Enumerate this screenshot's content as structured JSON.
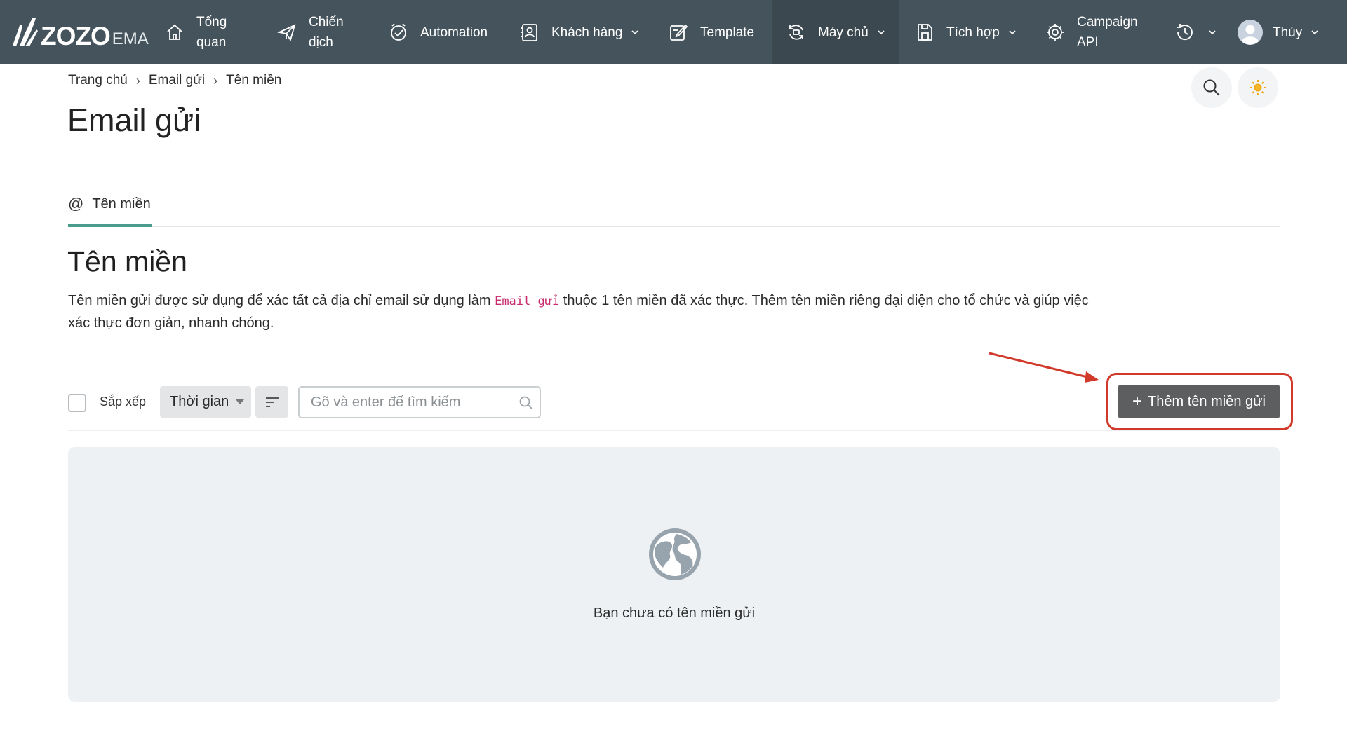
{
  "brand": {
    "name": "ZOZO",
    "suffix": "EMA"
  },
  "nav": {
    "items": [
      {
        "id": "overview",
        "label_line1": "Tổng",
        "label_line2": "quan",
        "icon": "home-icon"
      },
      {
        "id": "campaign",
        "label_line1": "Chiến",
        "label_line2": "dịch",
        "icon": "paper-plane-icon"
      },
      {
        "id": "automation",
        "label": "Automation",
        "icon": "clock-check-icon"
      },
      {
        "id": "customers",
        "label": "Khách hàng",
        "icon": "contacts-icon",
        "dropdown": true
      },
      {
        "id": "template",
        "label": "Template",
        "icon": "edit-icon"
      },
      {
        "id": "servers",
        "label": "Máy chủ",
        "icon": "server-sync-icon",
        "dropdown": true,
        "active": true
      },
      {
        "id": "integration",
        "label": "Tích hợp",
        "icon": "integration-icon",
        "dropdown": true
      },
      {
        "id": "campaign_api",
        "label_line1": "Campaign",
        "label_line2": "API",
        "icon": "gear-api-icon"
      }
    ],
    "history_icon": "history-icon",
    "user": {
      "name": "Thúy",
      "icon": "avatar-icon"
    }
  },
  "breadcrumb": [
    "Trang chủ",
    "Email gửi",
    "Tên miền"
  ],
  "breadcrumb_separator": "›",
  "page": {
    "title": "Email gửi"
  },
  "tabs": [
    {
      "label": "Tên miền",
      "icon_glyph": "@",
      "active": true
    }
  ],
  "section": {
    "title": "Tên miền",
    "description_before": "Tên miền gửi được sử dụng để xác tất cả địa chỉ email sử dụng làm ",
    "description_code": "Email gửi",
    "description_after": " thuộc 1 tên miền đã xác thực. Thêm tên miền riêng đại diện cho tổ chức và giúp việc xác thực đơn giản, nhanh chóng."
  },
  "toolbar": {
    "sort_label": "Sắp xếp",
    "sort_value": "Thời gian",
    "search_placeholder": "Gõ và enter để tìm kiếm",
    "search_value": "",
    "add_button_plus": "+",
    "add_button_label": "Thêm tên miền gửi"
  },
  "empty_state": {
    "icon": "globe-icon",
    "text": "Bạn chưa có tên miền gửi"
  },
  "colors": {
    "navbar": "#45545c",
    "nav_active": "#3b484f",
    "tab_underline": "#4a9c8c",
    "code_text": "#c72a6d",
    "add_button": "#5d5e5f",
    "annotation": "#d13a2b",
    "empty_bg": "#eef1f3"
  }
}
